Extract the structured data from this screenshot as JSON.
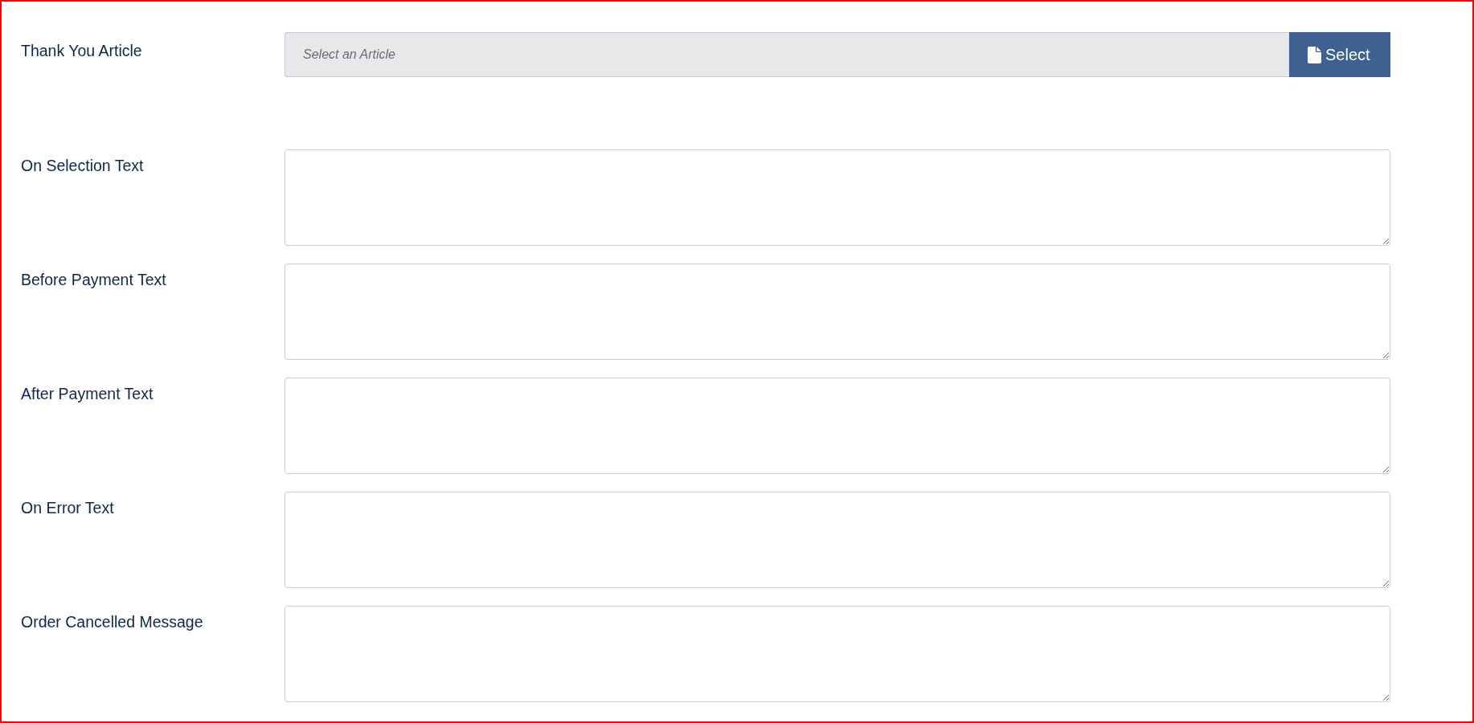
{
  "article_picker": {
    "label": "Thank You Article",
    "placeholder": "Select an Article",
    "button": "Select"
  },
  "text_fields": [
    {
      "label": "On Selection Text"
    },
    {
      "label": "Before Payment Text"
    },
    {
      "label": "After Payment Text"
    },
    {
      "label": "On Error Text"
    },
    {
      "label": "Order Cancelled Message"
    }
  ]
}
